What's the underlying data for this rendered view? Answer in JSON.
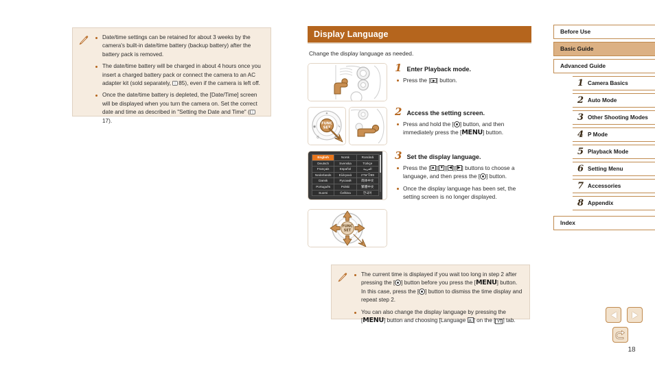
{
  "page": {
    "number": "18"
  },
  "top_note": {
    "icon": "pencil-note-icon",
    "items": [
      "Date/time settings can be retained for about 3 weeks by the camera's built-in date/time battery (backup battery) after the battery pack is removed.",
      "The date/time battery will be charged in about 4 hours once you insert a charged battery pack or connect the camera to an AC adapter kit (sold separately, ",
      "Once the date/time battery is depleted, the [Date/Time] screen will be displayed when you turn the camera on. Set the correct date and time as described in \"Setting the Date and Time\" ("
    ],
    "item2_tail": "85), even if the camera is left off.",
    "item3_tail": "17).",
    "ref_page_2": "85",
    "ref_page_3": "17"
  },
  "section": {
    "title": "Display Language",
    "lede": "Change the display language as needed."
  },
  "steps": [
    {
      "number": "1",
      "label": "Enter Playback mode.",
      "bullet_pre": "Press the [",
      "bullet_post": "] button.",
      "figure": "camera-rear-playback-button"
    },
    {
      "number": "2",
      "label": "Access the setting screen.",
      "bullet_a": "Press and hold the [",
      "bullet_b": "] button, and then immediately press the [",
      "bullet_c": "] button.",
      "menu_word": "MENU",
      "figure_left": "camera-control-dial-func-set",
      "figure_right": "camera-rear-menu-button"
    },
    {
      "number": "3",
      "label": "Set the display language.",
      "bullet1_pre": "Press the [",
      "bullet1_mid": "][",
      "bullet1_post": "] buttons to choose a language, and then press the [",
      "bullet1_end": "] button.",
      "bullet2": "Once the display language has been set, the setting screen is no longer displayed.",
      "figure": "language-selection-screen",
      "figure_bottom": "camera-dpad-four-arrows"
    }
  ],
  "language_screen": {
    "selected": "English",
    "rows": [
      [
        "English",
        "Norsk",
        "Română"
      ],
      [
        "Deutsch",
        "Svenska",
        "Türkçe"
      ],
      [
        "Français",
        "Español",
        "العربية"
      ],
      [
        "Nederlands",
        "Ελληνικά",
        "ภาษาไทย"
      ],
      [
        "Dansk",
        "Русский",
        "简体中文"
      ],
      [
        "Português",
        "Polski",
        "繁體中文"
      ],
      [
        "Suomi",
        "Čeština",
        "한국어"
      ]
    ]
  },
  "bottom_note": {
    "icon": "pencil-note-icon",
    "item1_a": "The current time is displayed if you wait too long in step 2 after pressing the [",
    "item1_b": "] button before you press the [",
    "item1_c": "] button. In this case, press the [",
    "item1_d": "] button to dismiss the time display and repeat step 2.",
    "item2_a": "You can also change the display language by pressing the [",
    "item2_b": "] button and choosing [Language ",
    "item2_c": "] on the [",
    "item2_d": "] tab.",
    "menu_word": "MENU",
    "tab_glyph": "settings-wrench-tab"
  },
  "sidebar": {
    "top_items": [
      {
        "label": "Before Use",
        "active": false
      },
      {
        "label": "Basic Guide",
        "active": true
      },
      {
        "label": "Advanced Guide",
        "active": false
      }
    ],
    "chapters": [
      {
        "num": "1",
        "label": "Camera Basics"
      },
      {
        "num": "2",
        "label": "Auto Mode"
      },
      {
        "num": "3",
        "label": "Other Shooting Modes"
      },
      {
        "num": "4",
        "label": "P Mode"
      },
      {
        "num": "5",
        "label": "Playback Mode"
      },
      {
        "num": "6",
        "label": "Setting Menu"
      },
      {
        "num": "7",
        "label": "Accessories"
      },
      {
        "num": "8",
        "label": "Appendix"
      }
    ],
    "index": {
      "label": "Index",
      "active": false
    }
  },
  "nav": {
    "prev": "previous-page",
    "next": "next-page",
    "back": "back-to-previous-view"
  },
  "colors": {
    "accent": "#b5651d",
    "note_bg": "#f6ece0",
    "sidebar_border": "#c08a4e",
    "sidebar_active": "#dcb184",
    "lang_selected": "#e8761c"
  }
}
